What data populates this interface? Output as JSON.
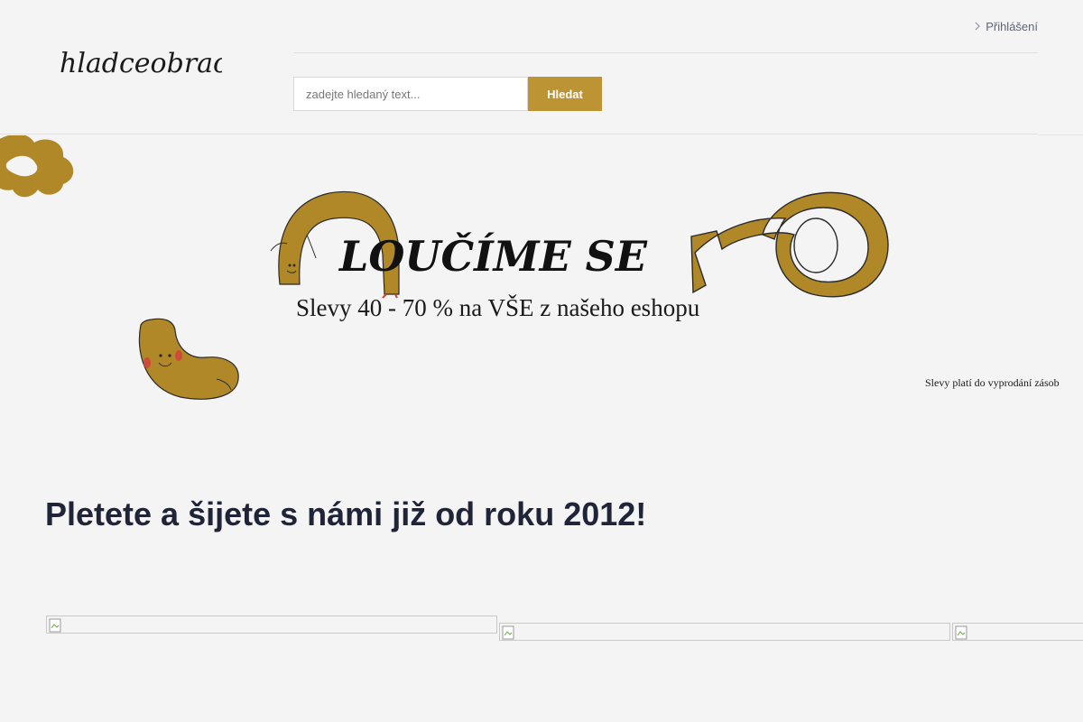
{
  "header": {
    "logo_text": "hladceobrace",
    "login_label": "Přihlášení",
    "search": {
      "placeholder": "zadejte hledaný text...",
      "value": "",
      "button_label": "Hledat"
    }
  },
  "banner": {
    "title": "LOUČÍME SE",
    "subtitle": "Slevy 40 - 70 % na VŠE z našeho eshopu",
    "note": "Slevy platí do vyprodání zásob"
  },
  "main": {
    "heading": "Pletete a šijete s námi již od roku 2012!",
    "gallery_images": [
      {
        "alt": ""
      },
      {
        "alt": ""
      },
      {
        "alt": ""
      }
    ]
  },
  "colors": {
    "accent": "#bc9434",
    "heading": "#1f2438",
    "background": "#f4f4f4"
  },
  "icons": {
    "login": "chevron-right-icon",
    "gallery": "broken-image-icon"
  }
}
